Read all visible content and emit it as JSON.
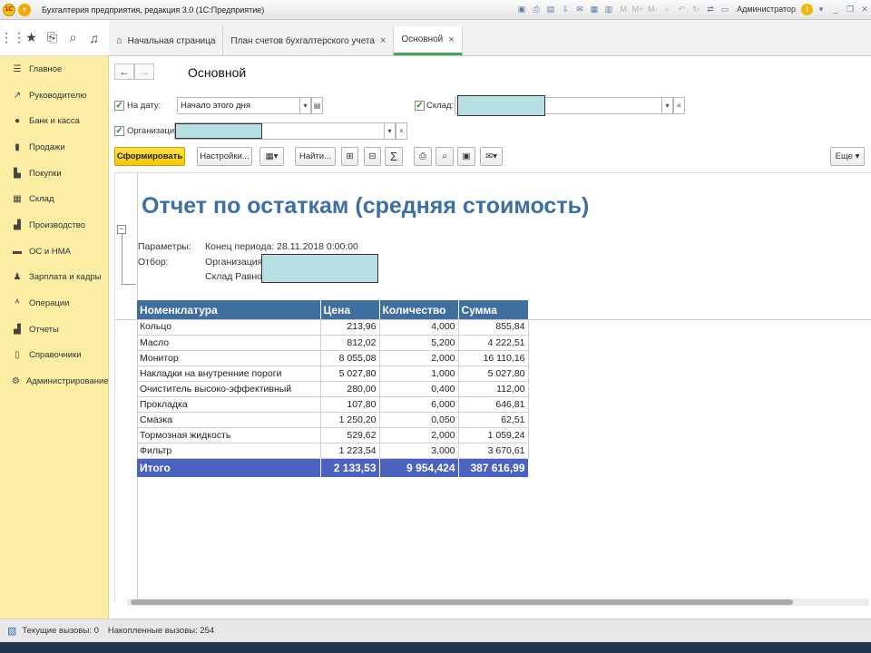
{
  "titlebar": {
    "title": "Бухгалтерия предприятия, редакция 3.0  (1С:Предприятие)",
    "user": "Администратор"
  },
  "tabs": [
    {
      "label": "Начальная страница"
    },
    {
      "label": "План счетов бухгалтерского учета"
    },
    {
      "label": "Основной"
    }
  ],
  "sidebar": {
    "items": [
      {
        "label": "Главное",
        "icon": "menu-icon"
      },
      {
        "label": "Руководителю",
        "icon": "trend-icon"
      },
      {
        "label": "Банк и касса",
        "icon": "coin-icon"
      },
      {
        "label": "Продажи",
        "icon": "bag-icon"
      },
      {
        "label": "Покупки",
        "icon": "cart-icon"
      },
      {
        "label": "Склад",
        "icon": "grid-icon"
      },
      {
        "label": "Производство",
        "icon": "factory-icon"
      },
      {
        "label": "ОС и НМА",
        "icon": "truck-icon"
      },
      {
        "label": "Зарплата и кадры",
        "icon": "person-icon"
      },
      {
        "label": "Операции",
        "icon": "ops-icon"
      },
      {
        "label": "Отчеты",
        "icon": "bar-chart-icon"
      },
      {
        "label": "Справочники",
        "icon": "book-icon"
      },
      {
        "label": "Администрирование",
        "icon": "gear-icon"
      }
    ]
  },
  "form": {
    "title": "Основной",
    "date_label": "На дату:",
    "date_value": "Начало этого дня",
    "warehouse_label": "Склад:",
    "org_label": "Организация:"
  },
  "toolbar": {
    "generate": "Сформировать",
    "settings": "Настройки...",
    "find": "Найти...",
    "more": "Еще"
  },
  "report": {
    "title": "Отчет по остаткам (средняя стоимость)",
    "params_label": "Параметры:",
    "params_value": "Конец периода: 28.11.2018 0:00:00",
    "filter_label": "Отбор:",
    "filter_org": "Организация",
    "filter_wh": "Склад Равно",
    "columns": [
      "Номенклатура",
      "Цена",
      "Количество",
      "Сумма"
    ],
    "rows": [
      {
        "name": "Кольцо",
        "price": "213,96",
        "qty": "4,000",
        "sum": "855,84"
      },
      {
        "name": "Масло",
        "price": "812,02",
        "qty": "5,200",
        "sum": "4 222,51"
      },
      {
        "name": "Монитор",
        "price": "8 055,08",
        "qty": "2,000",
        "sum": "16 110,16"
      },
      {
        "name": "Накладки на внутренние пороги",
        "price": "5 027,80",
        "qty": "1,000",
        "sum": "5 027,80"
      },
      {
        "name": "Очиститель высоко-эффективный",
        "price": "280,00",
        "qty": "0,400",
        "sum": "112,00"
      },
      {
        "name": "Прокладка",
        "price": "107,80",
        "qty": "6,000",
        "sum": "646,81"
      },
      {
        "name": "Смазка",
        "price": "1 250,20",
        "qty": "0,050",
        "sum": "62,51"
      },
      {
        "name": "Тормозная жидкость",
        "price": "529,62",
        "qty": "2,000",
        "sum": "1 059,24"
      },
      {
        "name": "Фильтр",
        "price": "1 223,54",
        "qty": "3,000",
        "sum": "3 670,61"
      }
    ],
    "total": {
      "name": "Итого",
      "price": "2 133,53",
      "qty": "9 954,424",
      "sum": "387 616,99"
    }
  },
  "status": {
    "current_calls": "Текущие вызовы: 0",
    "accumulated_calls": "Накопленные вызовы: 254"
  }
}
